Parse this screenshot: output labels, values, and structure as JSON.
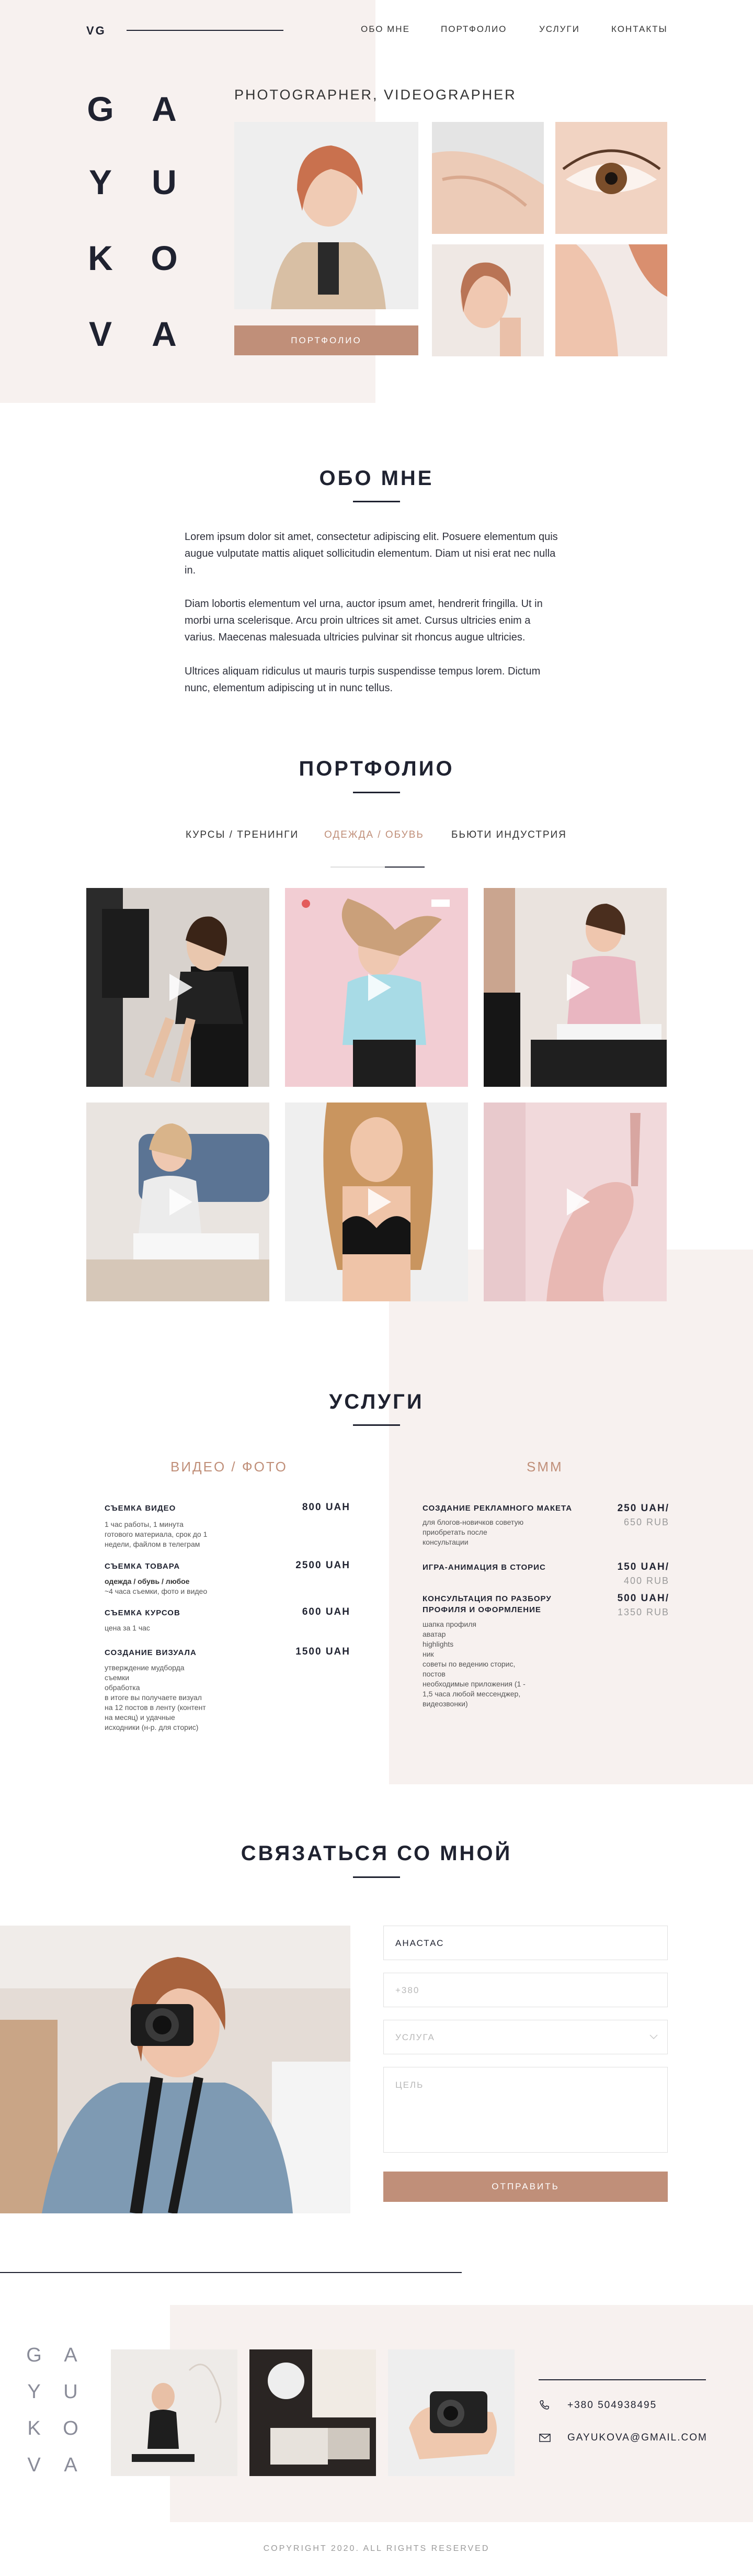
{
  "header": {
    "logo": "VG",
    "nav": [
      "ОБО МНЕ",
      "ПОРТФОЛИО",
      "УСЛУГИ",
      "КОНТАКТЫ"
    ]
  },
  "hero": {
    "letters": [
      "G",
      "A",
      "Y",
      "U",
      "K",
      "O",
      "V",
      "A"
    ],
    "subtitle": "PHOTOGRAPHER, VIDEOGRAPHER",
    "button": "ПОРТФОЛИО"
  },
  "about": {
    "title": "ОБО МНЕ",
    "paragraphs": [
      "Lorem ipsum dolor sit amet, consectetur adipiscing elit. Posuere elementum quis augue vulputate mattis aliquet sollicitudin elementum. Diam ut nisi erat nec nulla in.",
      "Diam lobortis elementum vel urna, auctor ipsum amet, hendrerit fringilla. Ut in morbi urna scelerisque. Arcu proin ultrices sit amet. Cursus ultricies enim a varius. Maecenas malesuada ultricies pulvinar sit rhoncus augue ultricies.",
      "Ultrices aliquam ridiculus ut mauris turpis suspendisse tempus lorem. Dictum nunc, elementum adipiscing ut in nunc tellus."
    ]
  },
  "portfolio": {
    "title": "ПОРТФОЛИО",
    "tabs": [
      "КУРСЫ / ТРЕНИНГИ",
      "ОДЕЖДА / ОБУВЬ",
      "БЬЮТИ ИНДУСТРИЯ"
    ],
    "active_tab": 1
  },
  "services": {
    "title": "УСЛУГИ",
    "left": {
      "title": "ВИДЕО / ФОТО",
      "items": [
        {
          "name": "СЪЕМКА ВИДЕО",
          "price": "800 UAH",
          "desc": [
            "1 час работы, 1 минута",
            "готового материала, срок до 1",
            "недели, файлом в телеграм"
          ]
        },
        {
          "name": "СЪЕМКА ТОВАРА",
          "price": "2500 UAH",
          "desc_bold": "одежда / обувь / любое",
          "desc": [
            "~4 часа съемки, фото и видео"
          ]
        },
        {
          "name": "СЪЕМКА КУРСОВ",
          "price": "600 UAH",
          "desc": [
            "цена за 1 час"
          ]
        },
        {
          "name": "СОЗДАНИЕ ВИЗУАЛА",
          "price": "1500 UAH",
          "desc": [
            "утверждение мудборда",
            "съемки",
            "обработка",
            "в итоге вы получаете визуал",
            "на 12 постов в ленту (контент",
            "на месяц) и удачные",
            "исходники (н-р. для сторис)"
          ]
        }
      ]
    },
    "right": {
      "title": "SMM",
      "items": [
        {
          "name": [
            "СОЗДАНИЕ РЕКЛАМНОГО МАКЕТА"
          ],
          "price": "250 UAH/",
          "old": "650 RUB",
          "desc": [
            "для блогов-новичков советую",
            "приобретать после",
            "консультации"
          ]
        },
        {
          "name": [
            "ИГРА-АНИМАЦИЯ В СТОРИС"
          ],
          "price": "150 UAH/",
          "old": "400 RUB",
          "desc": []
        },
        {
          "name": [
            "КОНСУЛЬТАЦИЯ ПО РАЗБОРУ",
            "ПРОФИЛЯ И ОФОРМЛЕНИЕ"
          ],
          "price": "500 UAH/",
          "old": "1350 RUB",
          "desc": [
            "шапка профиля",
            "аватар",
            "highlights",
            "ник",
            "советы по ведению сторис,",
            "постов",
            "необходимые приложения (1 -",
            "1,5 часа любой мессенджер,",
            "видеозвонки)"
          ]
        }
      ]
    }
  },
  "contact": {
    "title": "СВЯЗАТЬСЯ СО МНОЙ",
    "name_value": "АНАСТАС",
    "phone_placeholder": "+380",
    "service_placeholder": "УСЛУГА",
    "goal_placeholder": "ЦЕЛЬ",
    "submit": "ОТПРАВИТЬ"
  },
  "footer": {
    "letters": [
      "G",
      "A",
      "Y",
      "U",
      "K",
      "O",
      "V",
      "A"
    ],
    "phone": "+380 504938495",
    "email": "GAYUKOVA@GMAIL.COM",
    "copyright": "COPYRIGHT 2020. ALL RIGHTS RESERVED"
  },
  "colors": {
    "accent": "#c08f79",
    "tan_bg": "#f7f1ef",
    "text_dark": "#1f2230"
  },
  "icons": [
    "play-icon",
    "phone-icon",
    "mail-icon",
    "chevron-down-icon"
  ]
}
